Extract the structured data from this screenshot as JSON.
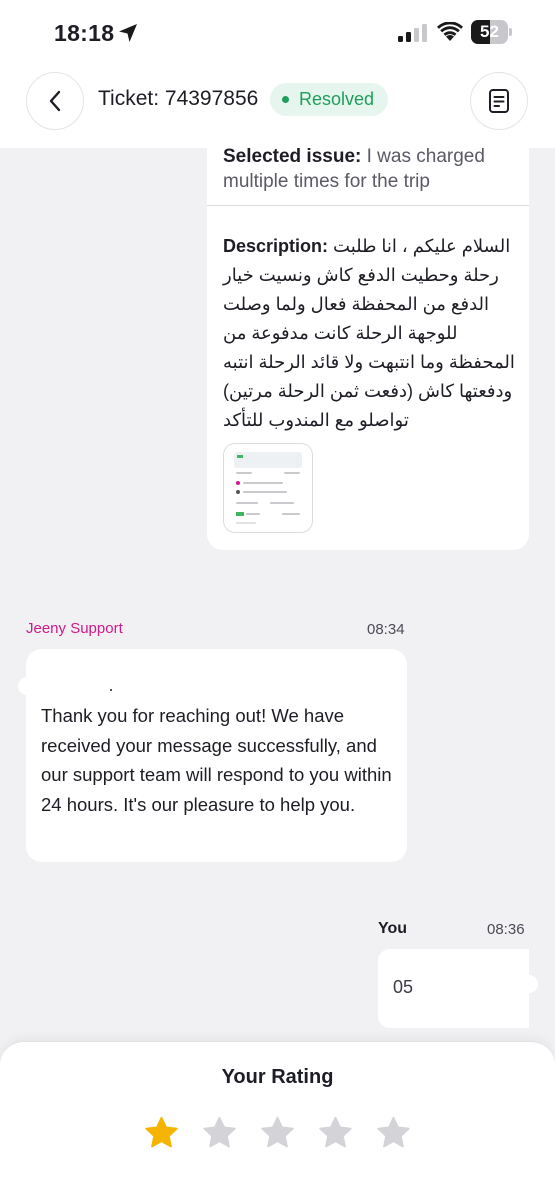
{
  "status_bar": {
    "time": "18:18",
    "battery_level": "52",
    "battery_fraction": 0.52
  },
  "header": {
    "ticket_title": "Ticket: 74397856",
    "status": "Resolved",
    "status_color": "#1e9e5a",
    "back_icon": "chevron-left-icon",
    "doc_icon": "document-icon"
  },
  "ticket": {
    "selected_issue_label": "Selected issue:",
    "selected_issue_value": "I was charged multiple times for the trip",
    "description_label": "Description:",
    "description_value": "السلام عليكم ، انا طلبت رحلة وحطيت الدفع كاش ونسيت خيار الدفع من المحفظة فعال ولما وصلت للوجهة الرحلة كانت مدفوعة من المحفظة وما انتبهت ولا قائد الرحلة انتبه ودفعتها كاش (دفعت ثمن الرحلة مرتين) تواصلو مع المندوب للتأكد"
  },
  "messages": [
    {
      "sender": "Jeeny Support",
      "time": "08:34",
      "text": "Thank you for reaching out! We have received your message successfully, and our support team will respond to you within 24 hours. It's our pleasure to help you.",
      "sender_color": "#d0198a"
    },
    {
      "sender": "You",
      "time": "08:36",
      "text": "05"
    }
  ],
  "rating": {
    "title": "Your Rating",
    "value": 1,
    "max": 5,
    "active_color": "#f5b400",
    "inactive_color": "#d3d3d8"
  }
}
